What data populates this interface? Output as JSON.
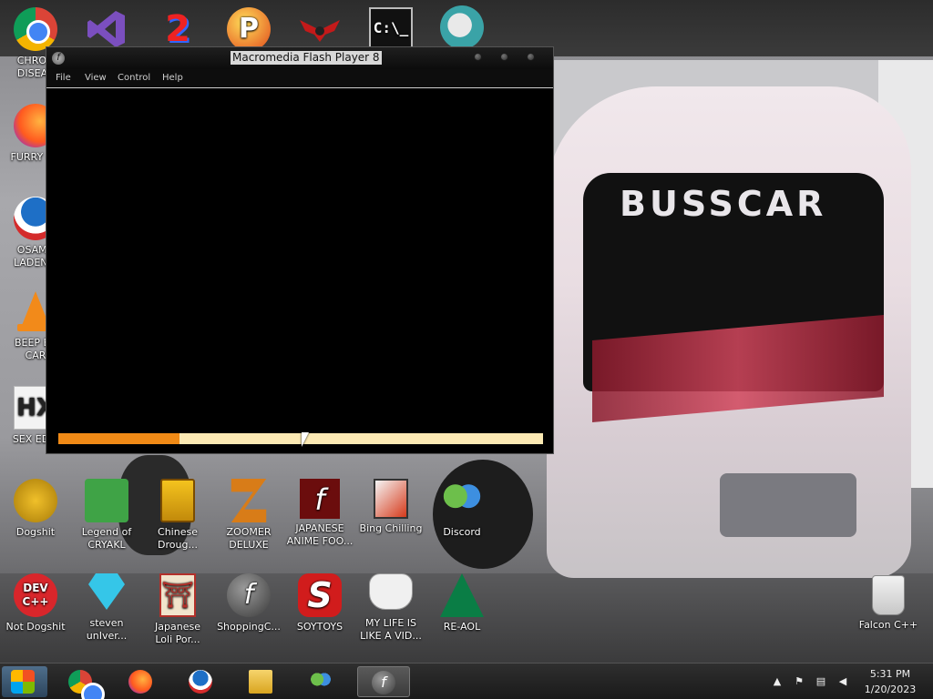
{
  "desktop": {
    "icons": [
      {
        "label": "CHRON\nDISEAS",
        "icon": "chrome-icon"
      },
      {
        "label": "",
        "icon": "visual-studio-icon"
      },
      {
        "label": "",
        "icon": "number-2-icon"
      },
      {
        "label": "",
        "icon": "p-ball-icon"
      },
      {
        "label": "",
        "icon": "red-emblem-icon"
      },
      {
        "label": "",
        "icon": "command-prompt-icon"
      },
      {
        "label": "",
        "icon": "santa-globe-icon"
      },
      {
        "label": "FURRY CU",
        "icon": "firefox-icon"
      },
      {
        "label": "OSAMA\nLADEN E",
        "icon": "obama-logo-icon"
      },
      {
        "label": "BEEP BE\nCAR",
        "icon": "vlc-cone-icon"
      },
      {
        "label": "SEX EDIT",
        "icon": "hex-editor-icon"
      },
      {
        "label": "Dogshit",
        "icon": "dogshit-icon"
      },
      {
        "label": "Legend of\nCRYAKL",
        "icon": "pixel-character-icon"
      },
      {
        "label": "Chinese\nDroug...",
        "icon": "mahjong-tile-icon"
      },
      {
        "label": "ZOOMER\nDELUXE",
        "icon": "zoomer-z-icon"
      },
      {
        "label": "JAPANESE\nANIME FOO...",
        "icon": "flash-red-icon"
      },
      {
        "label": "Bing Chilling",
        "icon": "bing-chilling-icon"
      },
      {
        "label": "Discord",
        "icon": "discord-messenger-icon"
      },
      {
        "label": "Not Dogshit",
        "icon": "dev-cpp-icon"
      },
      {
        "label": "steven\nunIver...",
        "icon": "diamond-gem-icon"
      },
      {
        "label": "Japanese\nLoli Por...",
        "icon": "torii-gate-icon"
      },
      {
        "label": "ShoppingC...",
        "icon": "flash-player-icon"
      },
      {
        "label": "SOYTOYS",
        "icon": "soytoys-s-icon"
      },
      {
        "label": "MY LIFE IS\nLIKE A VID...",
        "icon": "gamepad-icon"
      },
      {
        "label": "RE-AOL",
        "icon": "aol-triangle-icon"
      },
      {
        "label": "Falcon C++",
        "icon": "recycle-bin-icon"
      }
    ],
    "wallpaper_text": "BUSSCAR"
  },
  "window": {
    "title": "Macromedia Flash Player 8",
    "menu": [
      "File",
      "View",
      "Control",
      "Help"
    ],
    "progress_fraction": 0.25,
    "progress_fill_color": "#f08a16",
    "progress_track_color": "#fbe9b3"
  },
  "taskbar": {
    "items": [
      "start-button",
      "chrome-icon",
      "firefox-icon",
      "obama-logo-icon",
      "file-explorer-icon",
      "messenger-icon",
      "flash-player-icon"
    ],
    "clock": {
      "time": "5:31 PM",
      "date": "1/20/2023"
    },
    "tray": [
      "show-hidden-icons-icon",
      "action-center-flag-icon",
      "network-icon",
      "volume-icon"
    ]
  }
}
